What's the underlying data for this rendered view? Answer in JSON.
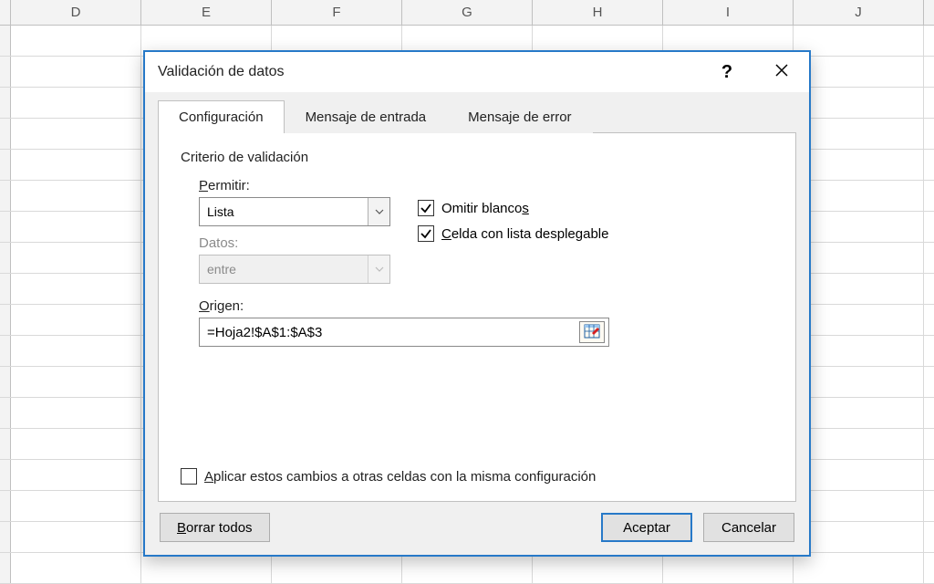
{
  "columns": [
    "D",
    "E",
    "F",
    "G",
    "H",
    "I",
    "J"
  ],
  "dialog": {
    "title": "Validación de datos",
    "help_label": "?",
    "tabs": {
      "config": "Configuración",
      "input_msg": "Mensaje de entrada",
      "error_msg": "Mensaje de error"
    },
    "group_label": "Criterio de validación",
    "permit_label": "Permitir:",
    "permit_value": "Lista",
    "data_label": "Datos:",
    "data_value": "entre",
    "ignore_blank_label_pre": "Omitir blanco",
    "ignore_blank_label_u": "s",
    "dropdown_label_u": "C",
    "dropdown_label_post": "elda con lista desplegable",
    "source_label_u": "O",
    "source_label_post": "rigen:",
    "source_value": "=Hoja2!$A$1:$A$3",
    "apply_label_u": "A",
    "apply_label_post": "plicar estos cambios a otras celdas con la misma configuración",
    "clear_label_u": "B",
    "clear_label_post": "orrar todos",
    "accept_label": "Aceptar",
    "cancel_label": "Cancelar"
  }
}
